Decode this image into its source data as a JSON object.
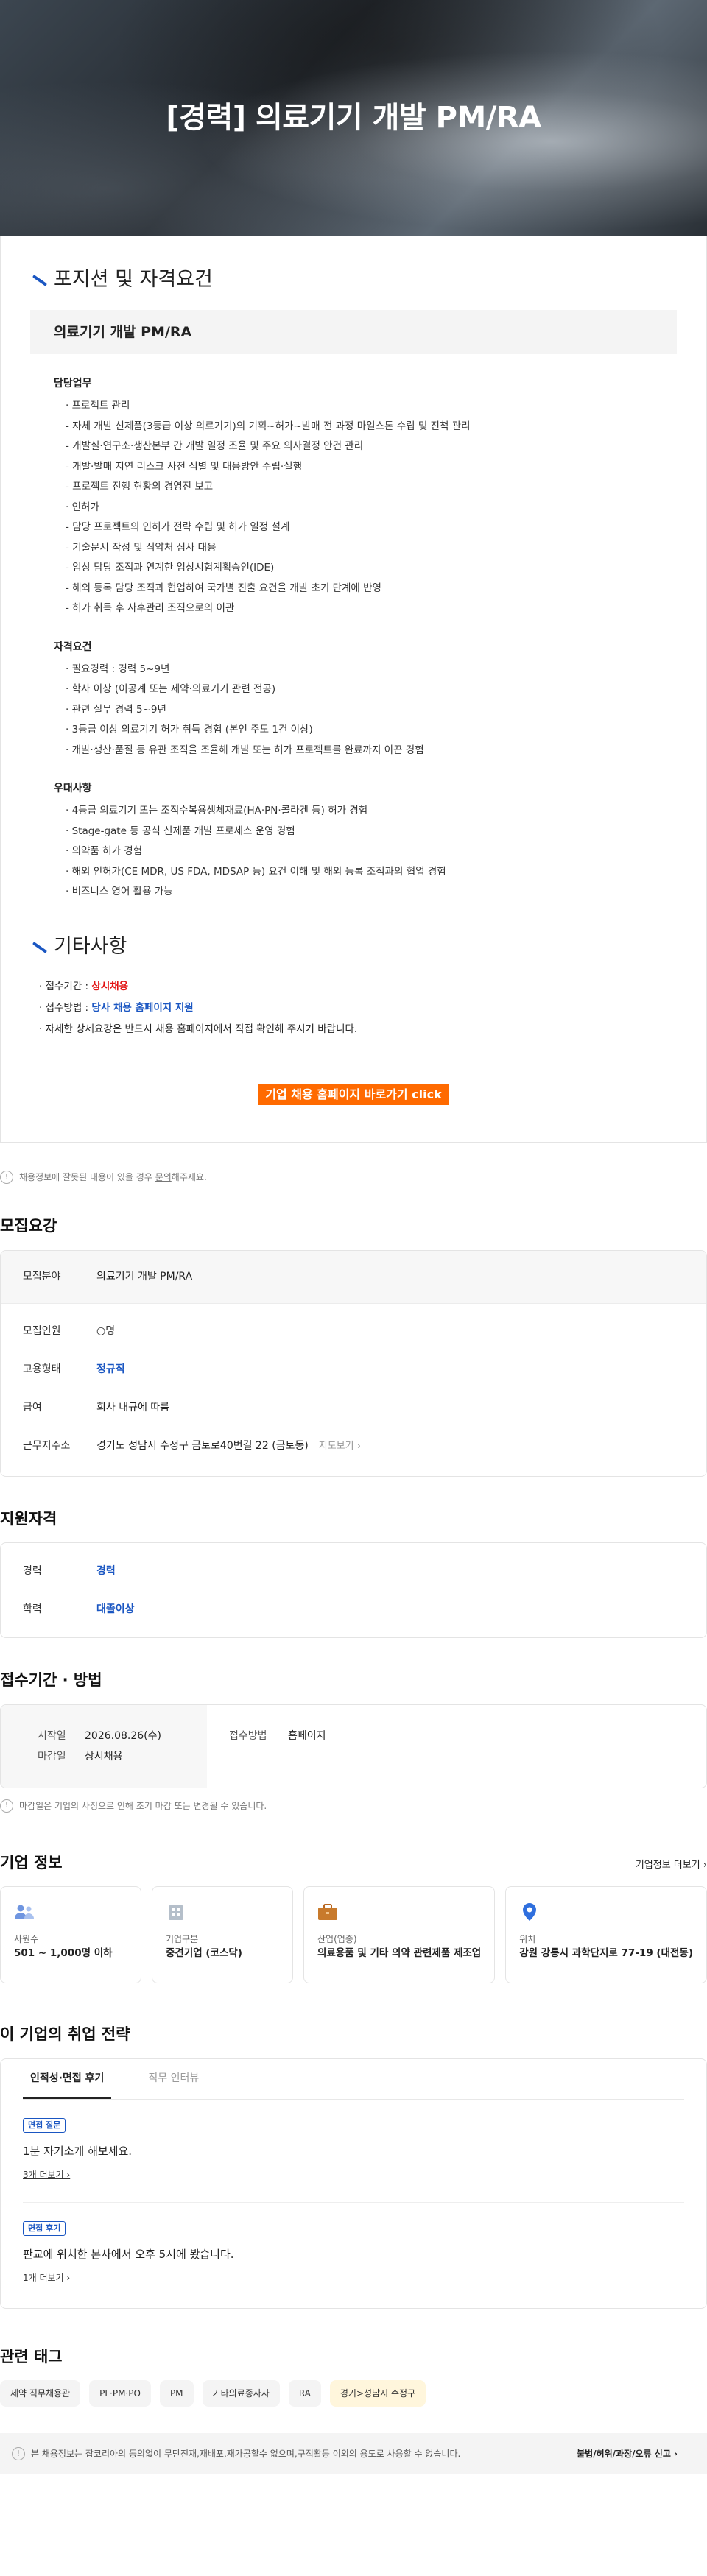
{
  "hero": {
    "title": "[경력] 의료기기 개발 PM/RA"
  },
  "position_section": {
    "heading": "포지션 및 자격요건",
    "band": "의료기기 개발 PM/RA",
    "duties": {
      "title": "담당업무",
      "lines": [
        "· 프로젝트 관리",
        "- 자체 개발 신제품(3등급 이상 의료기기)의 기획~허가~발매 전 과정 마일스톤 수립 및 진척 관리",
        "- 개발실·연구소·생산본부 간 개발 일정 조율 및 주요 의사결정 안건 관리",
        "- 개발·발매 지연 리스크 사전 식별 및 대응방안 수립·실행",
        "- 프로젝트 진행 현황의 경영진 보고",
        "· 인허가",
        "- 담당 프로젝트의 인허가 전략 수립 및 허가 일정 설계",
        "- 기술문서 작성 및 식약처 심사 대응",
        "- 임상 담당 조직과 연계한 임상시험계획승인(IDE)",
        "- 해외 등록 담당 조직과 협업하여 국가별 진출 요건을 개발 초기 단계에 반영",
        "- 허가 취득 후 사후관리 조직으로의 이관"
      ]
    },
    "qualifications": {
      "title": "자격요건",
      "lines": [
        "· 필요경력 : 경력 5~9년",
        "· 학사 이상 (이공계 또는 제약·의료기기 관련 전공)",
        "· 관련 실무 경력 5~9년",
        "· 3등급 이상 의료기기 허가 취득 경험 (본인 주도 1건 이상)",
        "· 개발·생산·품질 등 유관 조직을 조율해 개발 또는 허가 프로젝트를 완료까지 이끈 경험"
      ]
    },
    "preferred": {
      "title": "우대사항",
      "lines": [
        "· 4등급 의료기기 또는 조직수복용생체재료(HA·PN·콜라겐 등) 허가 경험",
        "· Stage-gate 등 공식 신제품 개발 프로세스 운영 경험",
        "· 의약품 허가 경험",
        "· 해외 인허가(CE MDR, US FDA, MDSAP 등) 요건 이해 및 해외 등록 조직과의 협업 경험",
        "· 비즈니스 영어 활용 가능"
      ]
    }
  },
  "etc_section": {
    "heading": "기타사항",
    "receipt_label": "· 접수기간 : ",
    "receipt_value": "상시채용",
    "method_label": "· 접수방법 : ",
    "method_value": "당사 채용 홈페이지 지원",
    "detail_line": "· 자세한 상세요강은 반드시 채용 홈페이지에서 직접 확인해 주시기 바랍니다.",
    "cta": "기업 채용 홈페이지 바로가기 click"
  },
  "report_notice": {
    "prefix": "채용정보에 잘못된 내용이 있을 경우 ",
    "link": "문의",
    "suffix": "해주세요."
  },
  "recruit_summary": {
    "title": "모집요강",
    "field_label": "모집분야",
    "field_value": "의료기기 개발 PM/RA",
    "headcount_label": "모집인원",
    "headcount_value": "○명",
    "type_label": "고용형태",
    "type_value": "정규직",
    "salary_label": "급여",
    "salary_value": "회사 내규에 따름",
    "location_label": "근무지주소",
    "location_value": "경기도 성남시 수정구 금토로40번길 22 (금토동)",
    "map_link": "지도보기 ›"
  },
  "qualification_summary": {
    "title": "지원자격",
    "career_label": "경력",
    "career_value": "경력",
    "edu_label": "학력",
    "edu_value": "대졸이상"
  },
  "period": {
    "title": "접수기간 · 방법",
    "start_label": "시작일",
    "start_value": "2026.08.26(수)",
    "end_label": "마감일",
    "end_value": "상시채용",
    "method_label": "접수방법",
    "method_value": "홈페이지",
    "notice": "마감일은 기업의 사정으로 인해 조기 마감 또는 변경될 수 있습니다."
  },
  "company_info": {
    "title": "기업 정보",
    "more": "기업정보 더보기 ›",
    "cards": [
      {
        "icon": "people-icon",
        "label": "사원수",
        "value": "501 ~ 1,000명 이하"
      },
      {
        "icon": "building-icon",
        "label": "기업구분",
        "value": "중견기업 (코스닥)"
      },
      {
        "icon": "briefcase-icon",
        "label": "산업(업종)",
        "value": "의료용품 및 기타 의약 관련제품 제조업"
      },
      {
        "icon": "location-pin-icon",
        "label": "위치",
        "value": "강원 강릉시 과학단지로 77-19 (대전동)"
      }
    ]
  },
  "strategy": {
    "title": "이 기업의 취업 전략",
    "tabs": [
      "인적성·면접 후기",
      "직무 인터뷰"
    ],
    "reviews": [
      {
        "badge": "면접 질문",
        "text": "1분 자기소개 해보세요.",
        "more": "3개 더보기 ›"
      },
      {
        "badge": "면접 후기",
        "text": "판교에 위치한 본사에서 오후 5시에 봤습니다.",
        "more": "1개 더보기 ›"
      }
    ]
  },
  "tags": {
    "title": "관련 태그",
    "items": [
      "제약 직무채용관",
      "PL·PM·PO",
      "PM",
      "기타의료종사자",
      "RA",
      "경기>성남시 수정구"
    ]
  },
  "footer": {
    "text": "본 채용정보는 잡코리아의 동의없이 무단전재,재배포,재가공할수 없으며,구직활동 이외의 용도로 사용할 수 없습니다.",
    "report": "불법/허위/과장/오류 신고 ›"
  },
  "colors": {
    "accent_blue": "#1a56c2",
    "cta_orange": "#ff6a00",
    "alert_red": "#e21313"
  }
}
